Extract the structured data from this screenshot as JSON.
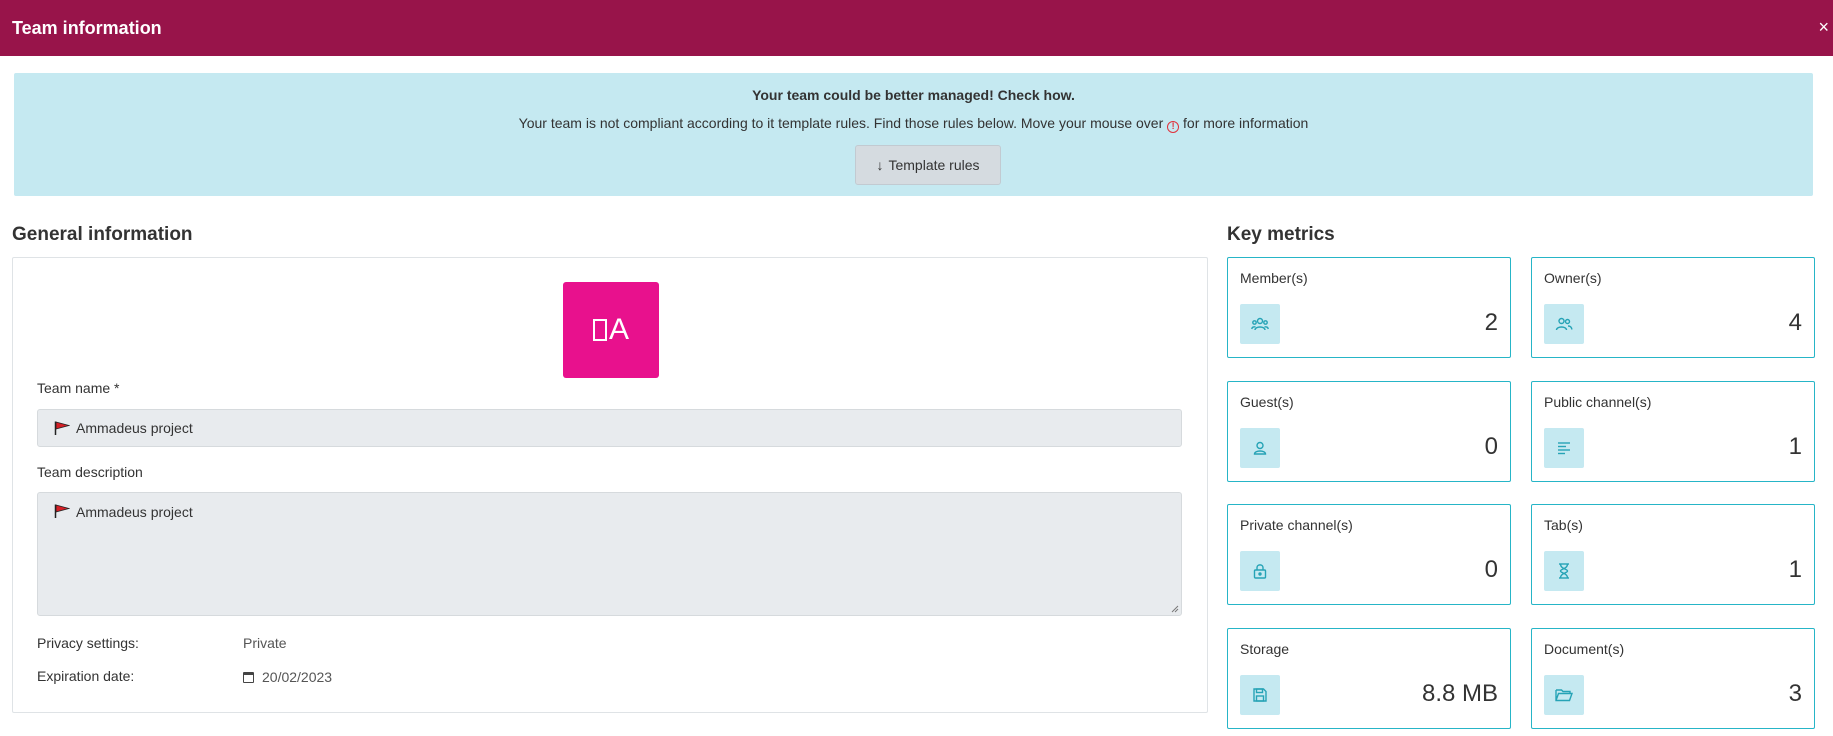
{
  "header": {
    "title": "Team information",
    "close_label": "×"
  },
  "alert": {
    "title": "Your team could be better managed! Check how.",
    "text_before": "Your team is not compliant according to it template rules. Find those rules below. Move your mouse over",
    "info_glyph": "!",
    "text_after": "for more information",
    "button_arrow": "↓",
    "button_label": "Template rules"
  },
  "general": {
    "title": "General information",
    "logo_letter": "A",
    "team_name_label": "Team name *",
    "team_name_value": "Ammadeus project",
    "team_description_label": "Team description",
    "team_description_value": "Ammadeus project",
    "privacy_label": "Privacy settings:",
    "privacy_value": "Private",
    "expiration_label": "Expiration date:",
    "expiration_value": "20/02/2023"
  },
  "metrics": {
    "title": "Key metrics",
    "items": [
      {
        "label": "Member(s)",
        "value": "2",
        "icon": "members-icon"
      },
      {
        "label": "Owner(s)",
        "value": "4",
        "icon": "owners-icon"
      },
      {
        "label": "Guest(s)",
        "value": "0",
        "icon": "guest-icon"
      },
      {
        "label": "Public channel(s)",
        "value": "1",
        "icon": "public-channel-icon"
      },
      {
        "label": "Private channel(s)",
        "value": "0",
        "icon": "lock-icon"
      },
      {
        "label": "Tab(s)",
        "value": "1",
        "icon": "hourglass-icon"
      },
      {
        "label": "Storage",
        "value": "8.8 MB",
        "icon": "save-icon"
      },
      {
        "label": "Document(s)",
        "value": "3",
        "icon": "folder-icon"
      }
    ]
  },
  "colors": {
    "header": "#98144a",
    "alert_bg": "#c5e9f1",
    "accent": "#26b5c7",
    "logo_bg": "#e8118d"
  }
}
